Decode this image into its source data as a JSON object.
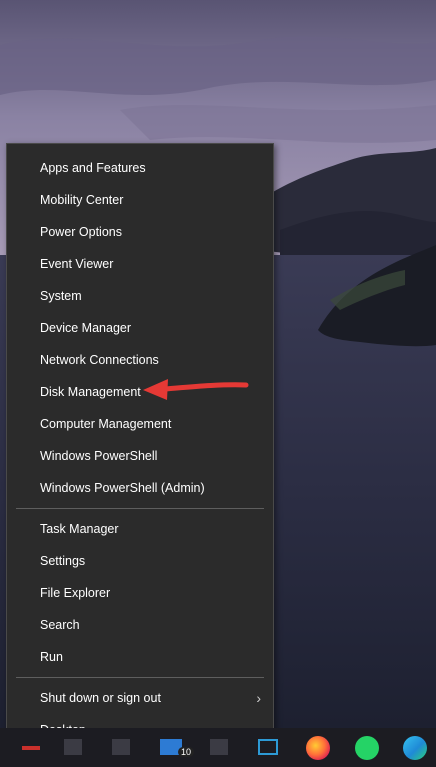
{
  "menu": {
    "group1": [
      {
        "label": "Apps and Features"
      },
      {
        "label": "Mobility Center"
      },
      {
        "label": "Power Options"
      },
      {
        "label": "Event Viewer"
      },
      {
        "label": "System"
      },
      {
        "label": "Device Manager"
      },
      {
        "label": "Network Connections"
      },
      {
        "label": "Disk Management"
      },
      {
        "label": "Computer Management"
      },
      {
        "label": "Windows PowerShell"
      },
      {
        "label": "Windows PowerShell (Admin)"
      }
    ],
    "group2": [
      {
        "label": "Task Manager"
      },
      {
        "label": "Settings"
      },
      {
        "label": "File Explorer"
      },
      {
        "label": "Search"
      },
      {
        "label": "Run"
      }
    ],
    "group3": [
      {
        "label": "Shut down or sign out",
        "has_submenu": true,
        "submenu_glyph": "›"
      },
      {
        "label": "Desktop"
      }
    ]
  },
  "annotation": {
    "points_to": "Disk Management",
    "color": "#e53935"
  },
  "taskbar": {
    "pinned_icons": [
      "firefox-icon",
      "whatsapp-icon",
      "edge-icon"
    ],
    "badge_text": "10"
  },
  "colors": {
    "menu_background": "#2b2b2b",
    "menu_text": "#ffffff",
    "separator": "#5e5e5e",
    "taskbar": "#1c1c22"
  }
}
